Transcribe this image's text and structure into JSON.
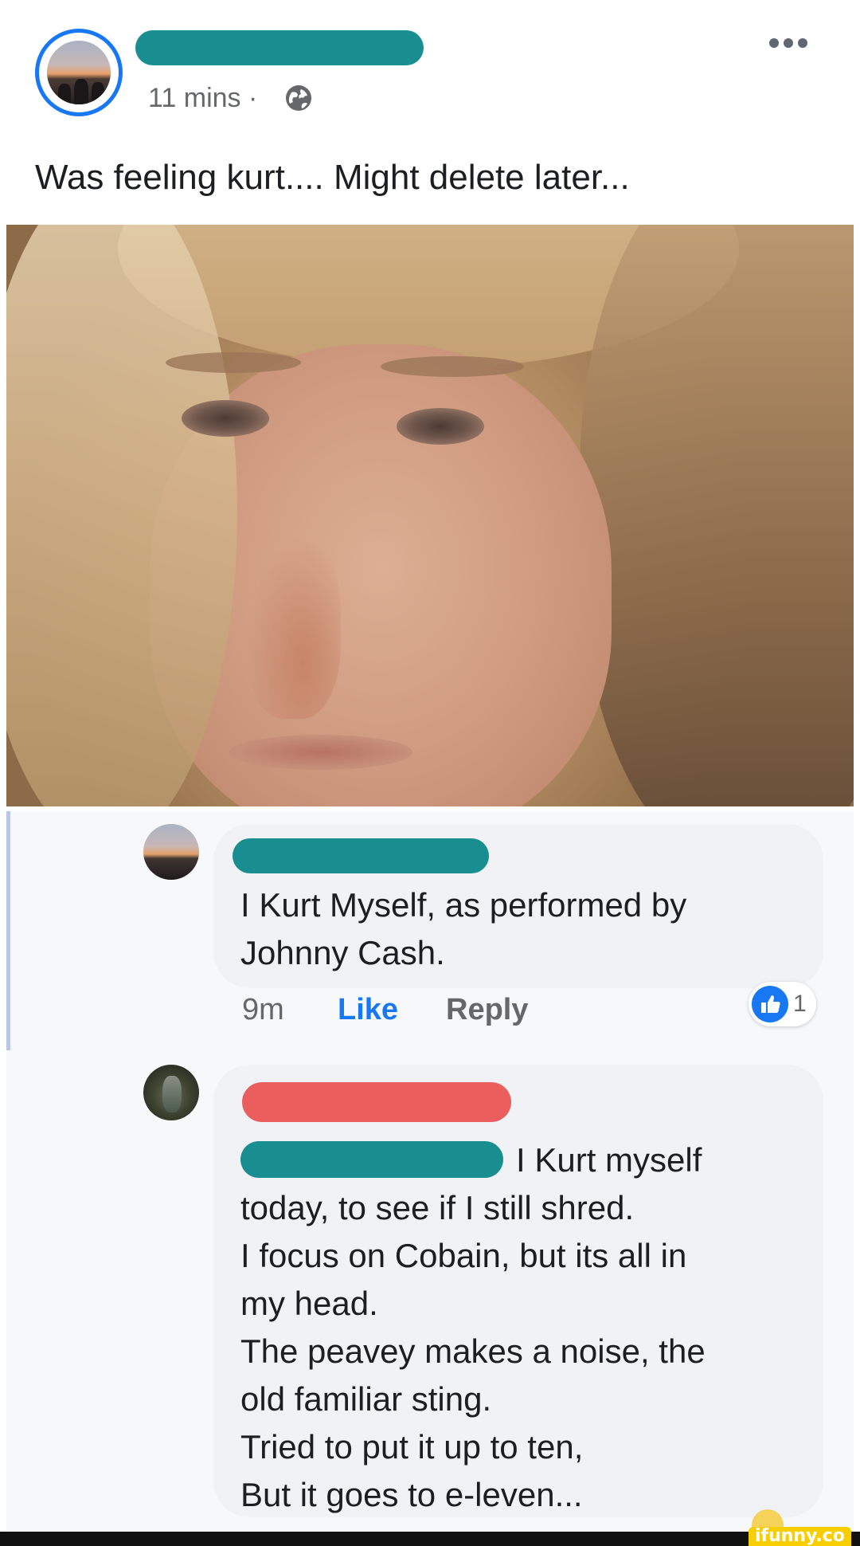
{
  "post": {
    "time": "11 mins",
    "separator": "·",
    "privacy_icon": "globe-icon",
    "more_icon": "more-options-icon",
    "text": "Was feeling kurt.... Might delete later...",
    "author_name_redacted": true
  },
  "comments": [
    {
      "avatar": "avatar-sunset",
      "name_redacted": true,
      "lines": [
        "I Kurt Myself, as performed by",
        "Johnny Cash."
      ],
      "time": "9m",
      "like_label": "Like",
      "reply_label": "Reply",
      "reaction_icon": "like-reaction-icon",
      "reaction_count": "1"
    },
    {
      "avatar": "avatar-outdoor",
      "name_redacted": true,
      "first_line_tail": "I Kurt myself",
      "lines": [
        "today, to see if I still shred.",
        "I focus on Cobain, but its all in",
        "my head.",
        "The peavey makes a noise, the",
        "old familiar sting.",
        "Tried to put it up to ten,",
        "But it goes to e-leven..."
      ]
    }
  ],
  "watermark": "ifunny.co",
  "colors": {
    "accent": "#1877f2",
    "redact_teal": "#188e91",
    "redact_red": "#ea5e5e",
    "bubble": "#f0f2f5",
    "meta_gray": "#65676b"
  }
}
